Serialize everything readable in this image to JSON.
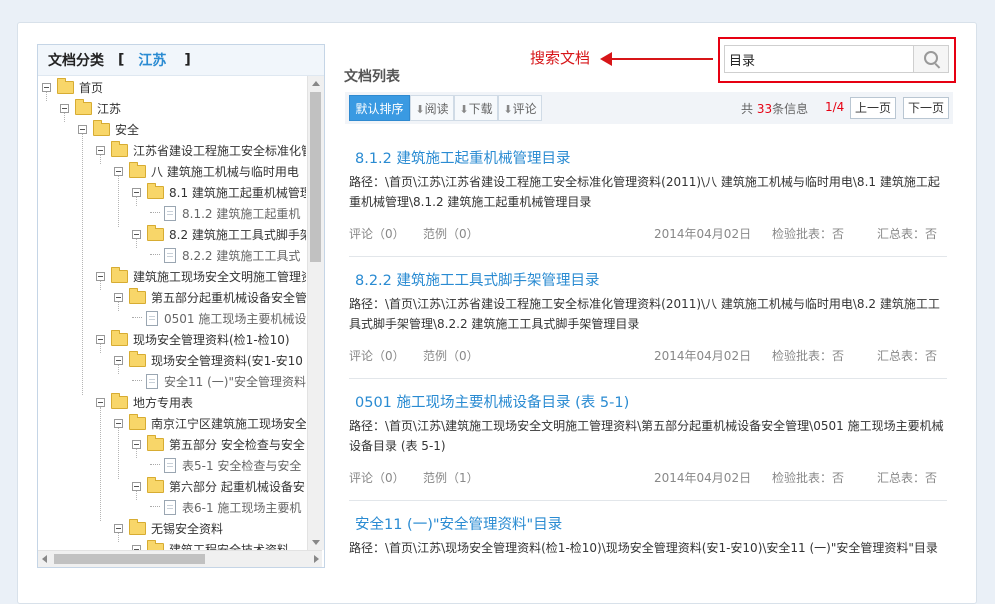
{
  "sidebar": {
    "title": "文档分类",
    "bracket_open": "[",
    "bracket_close": "]",
    "city": "江苏",
    "tree": [
      {
        "label": "首页",
        "type": "folder"
      },
      {
        "label": "江苏",
        "type": "folder"
      },
      {
        "label": "安全",
        "type": "folder"
      },
      {
        "label": "江苏省建设工程施工安全标准化管",
        "type": "folder"
      },
      {
        "label": "八 建筑施工机械与临时用电",
        "type": "folder"
      },
      {
        "label": "8.1 建筑施工起重机械管理",
        "type": "folder"
      },
      {
        "label": "8.1.2 建筑施工起重机",
        "type": "file"
      },
      {
        "label": "8.2 建筑施工工具式脚手架",
        "type": "folder"
      },
      {
        "label": "8.2.2 建筑施工工具式",
        "type": "file"
      },
      {
        "label": "建筑施工现场安全文明施工管理资",
        "type": "folder"
      },
      {
        "label": "第五部分起重机械设备安全管",
        "type": "folder"
      },
      {
        "label": "0501 施工现场主要机械设",
        "type": "file"
      },
      {
        "label": "现场安全管理资料(检1-检10)",
        "type": "folder"
      },
      {
        "label": "现场安全管理资料(安1-安10",
        "type": "folder"
      },
      {
        "label": "安全11 (一)\"安全管理资料",
        "type": "file"
      },
      {
        "label": "地方专用表",
        "type": "folder"
      },
      {
        "label": "南京江宁区建筑施工现场安全",
        "type": "folder"
      },
      {
        "label": "第五部分 安全检查与安全",
        "type": "folder"
      },
      {
        "label": "表5-1 安全检查与安全",
        "type": "file"
      },
      {
        "label": "第六部分 起重机械设备安",
        "type": "folder"
      },
      {
        "label": "表6-1 施工现场主要机",
        "type": "file"
      },
      {
        "label": "无锡安全资料",
        "type": "folder"
      },
      {
        "label": "建筑工程安全技术资料",
        "type": "folder"
      }
    ]
  },
  "annotation": {
    "text": "搜索文档"
  },
  "search": {
    "value": "目录"
  },
  "list": {
    "title": "文档列表",
    "sort_buttons": [
      {
        "label": "默认排序",
        "arrow": ""
      },
      {
        "label": "阅读",
        "arrow": "⬇"
      },
      {
        "label": "下载",
        "arrow": "⬇"
      },
      {
        "label": "评论",
        "arrow": "⬇"
      }
    ],
    "pager": {
      "total_prefix": "共",
      "total": "33",
      "total_suffix": "条信息",
      "page": "1/4",
      "prev": "上一页",
      "next": "下一页"
    },
    "items": [
      {
        "title": "8.1.2 建筑施工起重机械管理目录",
        "path": "路径：\\首页\\江苏\\江苏省建设工程施工安全标准化管理资料(2011)\\八 建筑施工机械与临时用电\\8.1 建筑施工起重机械管理\\8.1.2 建筑施工起重机械管理目录",
        "comments": "评论（0）",
        "examples": "范例（0）",
        "date": "2014年04月02日",
        "inspect": "检验批表：否",
        "summary": "汇总表：否"
      },
      {
        "title": "8.2.2 建筑施工工具式脚手架管理目录",
        "path": "路径：\\首页\\江苏\\江苏省建设工程施工安全标准化管理资料(2011)\\八 建筑施工机械与临时用电\\8.2 建筑施工工具式脚手架管理\\8.2.2 建筑施工工具式脚手架管理目录",
        "comments": "评论（0）",
        "examples": "范例（0）",
        "date": "2014年04月02日",
        "inspect": "检验批表：否",
        "summary": "汇总表：否"
      },
      {
        "title": "0501 施工现场主要机械设备目录 (表 5-1)",
        "path": "路径：\\首页\\江苏\\建筑施工现场安全文明施工管理资料\\第五部分起重机械设备安全管理\\0501 施工现场主要机械设备目录 (表 5-1)",
        "comments": "评论（0）",
        "examples": "范例（1）",
        "date": "2014年04月02日",
        "inspect": "检验批表：否",
        "summary": "汇总表：否"
      },
      {
        "title": "安全11 (一)\"安全管理资料\"目录",
        "path": "路径：\\首页\\江苏\\现场安全管理资料(检1-检10)\\现场安全管理资料(安1-安10)\\安全11 (一)\"安全管理资料\"目录"
      }
    ]
  }
}
